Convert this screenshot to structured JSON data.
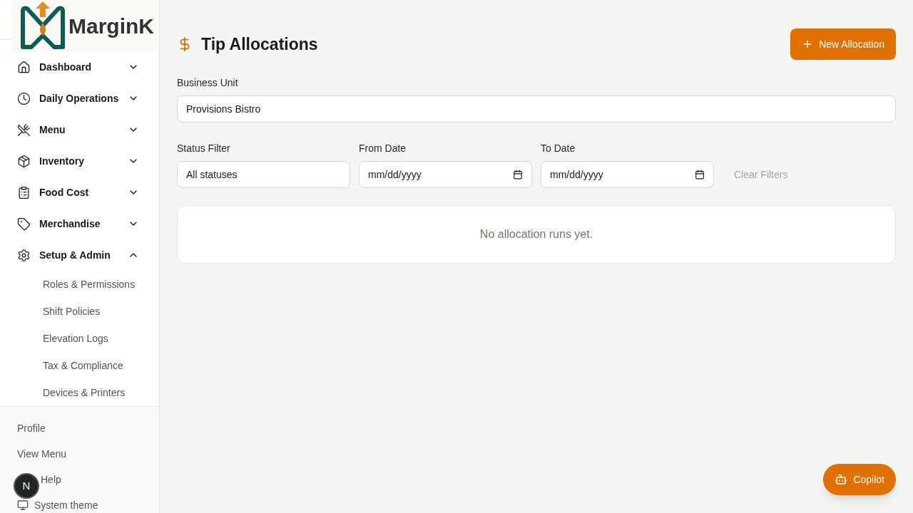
{
  "logo": {
    "text": "MarginK"
  },
  "nav": [
    {
      "label": "Dashboard",
      "expanded": false
    },
    {
      "label": "Daily Operations",
      "expanded": false
    },
    {
      "label": "Menu",
      "expanded": false
    },
    {
      "label": "Inventory",
      "expanded": false
    },
    {
      "label": "Food Cost",
      "expanded": false
    },
    {
      "label": "Merchandise",
      "expanded": false
    },
    {
      "label": "Setup & Admin",
      "expanded": true,
      "children": [
        {
          "label": "Roles & Permissions"
        },
        {
          "label": "Shift Policies"
        },
        {
          "label": "Elevation Logs"
        },
        {
          "label": "Tax & Compliance"
        },
        {
          "label": "Devices & Printers"
        }
      ]
    }
  ],
  "footer_links": [
    {
      "label": "Profile",
      "kind": "plain"
    },
    {
      "label": "View Menu",
      "kind": "plain"
    },
    {
      "label": "Help",
      "kind": "indented"
    }
  ],
  "theme": "System theme",
  "dev_badge": "N",
  "page": {
    "title": "Tip Allocations",
    "new_button": "New Allocation",
    "business_unit": {
      "label": "Business Unit",
      "value": "Provisions Bistro"
    },
    "filters": [
      {
        "kind": "select",
        "label": "Status Filter",
        "value": "All statuses"
      },
      {
        "kind": "date",
        "label": "From Date",
        "value": "mm/dd/yyyy"
      },
      {
        "kind": "date",
        "label": "To Date",
        "value": "mm/dd/yyyy"
      }
    ],
    "clear_button": "Clear Filters",
    "empty_message": "No allocation runs yet."
  },
  "copilot": "Copilot"
}
